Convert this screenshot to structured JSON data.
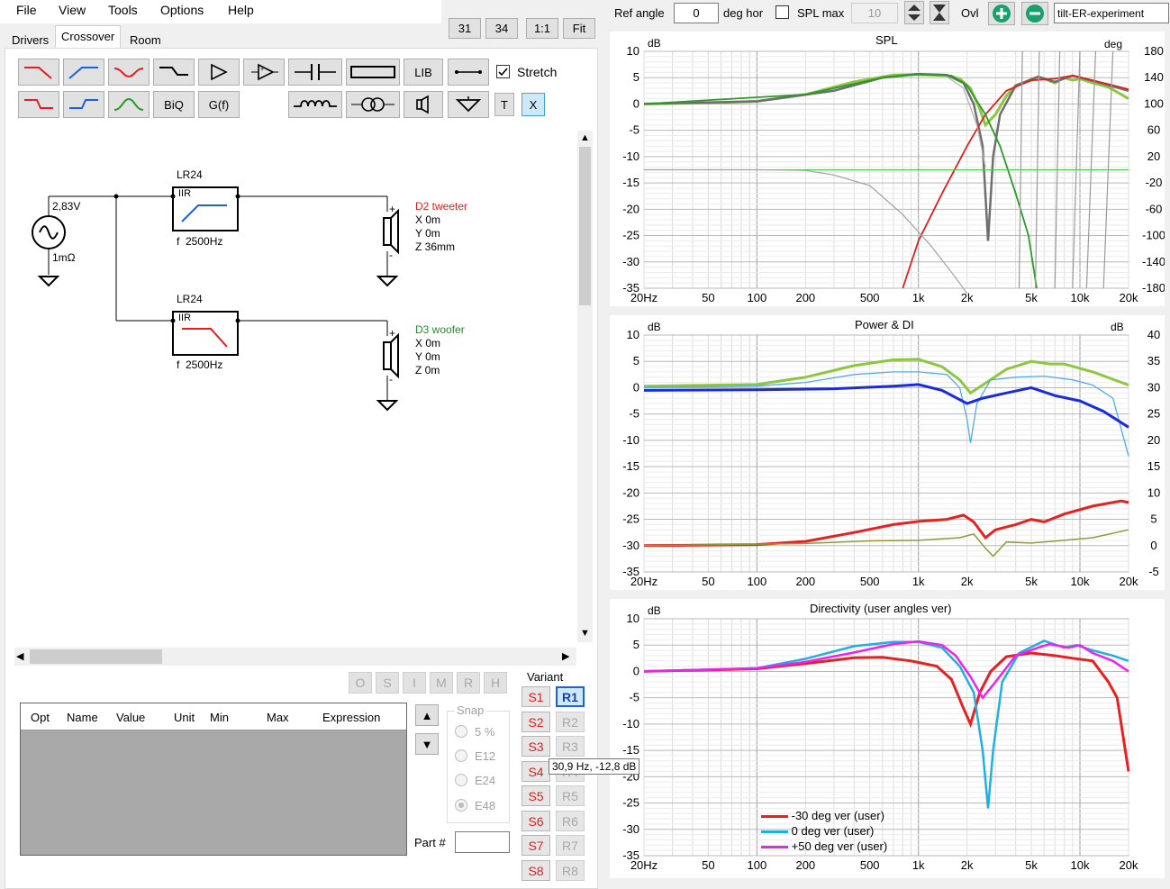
{
  "menu": {
    "file": "File",
    "view": "View",
    "tools": "Tools",
    "options": "Options",
    "help": "Help"
  },
  "tabs": {
    "drivers": "Drivers",
    "crossover": "Crossover",
    "room": "Room"
  },
  "zoom": {
    "b31": "31",
    "b34": "34",
    "b11": "1:1",
    "fit": "Fit"
  },
  "toolbar": {
    "lib": "LIB",
    "biq": "BiQ",
    "gf": "G(f)",
    "t": "T",
    "x": "X",
    "stretch": "Stretch",
    "stretch_checked": true
  },
  "schematic": {
    "source_voltage": "2,83V",
    "source_impedance": "1mΩ",
    "filter1": {
      "title": "LR24",
      "type": "IIR",
      "freq": "f  2500Hz"
    },
    "filter2": {
      "title": "LR24",
      "type": "IIR",
      "freq": "f  2500Hz"
    },
    "tweeter": {
      "name": "D2 tweeter",
      "x": "X 0m",
      "y": "Y 0m",
      "z": "Z 36mm",
      "color": "#e02020"
    },
    "woofer": {
      "name": "D3 woofer",
      "x": "X 0m",
      "y": "Y 0m",
      "z": "Z 0m",
      "color": "#2a8a2a"
    },
    "plus": "+",
    "minus": "-"
  },
  "opt_buttons": [
    "O",
    "S",
    "I",
    "M",
    "R",
    "H"
  ],
  "table": {
    "headers": [
      "Opt",
      "Name",
      "Value",
      "Unit",
      "Min",
      "Max",
      "Expression"
    ]
  },
  "snap": {
    "title": "Snap",
    "options": [
      "5 %",
      "E12",
      "E24",
      "E48"
    ],
    "selected": "E48"
  },
  "part": {
    "label": "Part #",
    "value": ""
  },
  "variant": {
    "title": "Variant",
    "s": [
      "S1",
      "S2",
      "S3",
      "S4",
      "S5",
      "S6",
      "S7",
      "S8"
    ],
    "r": [
      "R1",
      "R2",
      "R3",
      "R4",
      "R5",
      "R6",
      "R7",
      "R8"
    ],
    "active_r": "R1"
  },
  "tooltip": "30,9 Hz, -12,8 dB",
  "top": {
    "ref_angle_label": "Ref angle",
    "ref_angle": "0",
    "deg_hor": "deg hor",
    "spl_max": "SPL max",
    "spl_max_value": "10",
    "ovl": "Ovl",
    "project": "tilt-ER-experiment"
  },
  "graphs": {
    "spl": {
      "title": "SPL",
      "left_unit": "dB",
      "right_unit": "deg",
      "left_ticks": [
        "10",
        "5",
        "0",
        "-5",
        "-10",
        "-15",
        "-20",
        "-25",
        "-30",
        "-35"
      ],
      "right_ticks": [
        "180",
        "140",
        "100",
        "60",
        "20",
        "-20",
        "-60",
        "-100",
        "-140",
        "-180"
      ]
    },
    "power": {
      "title": "Power & DI",
      "left_unit": "dB",
      "right_unit": "dB",
      "left_ticks": [
        "10",
        "5",
        "0",
        "-5",
        "-10",
        "-15",
        "-20",
        "-25",
        "-30",
        "-35"
      ],
      "right_ticks": [
        "40",
        "35",
        "30",
        "25",
        "20",
        "15",
        "10",
        "5",
        "0",
        "-5"
      ]
    },
    "dir": {
      "title": "Directivity (user angles ver)",
      "left_unit": "dB",
      "left_ticks": [
        "10",
        "5",
        "0",
        "-5",
        "-10",
        "-15",
        "-20",
        "-25",
        "-30",
        "-35"
      ],
      "legend": [
        {
          "label": "-30 deg ver (user)",
          "color": "#e82020"
        },
        {
          "label": "0 deg ver (user)",
          "color": "#20b0e0"
        },
        {
          "label": "+50 deg ver (user)",
          "color": "#f020f0"
        }
      ]
    },
    "x_ticks": [
      "20Hz",
      "50",
      "100",
      "200",
      "500",
      "1k",
      "2k",
      "5k",
      "10k",
      "20k"
    ]
  }
}
